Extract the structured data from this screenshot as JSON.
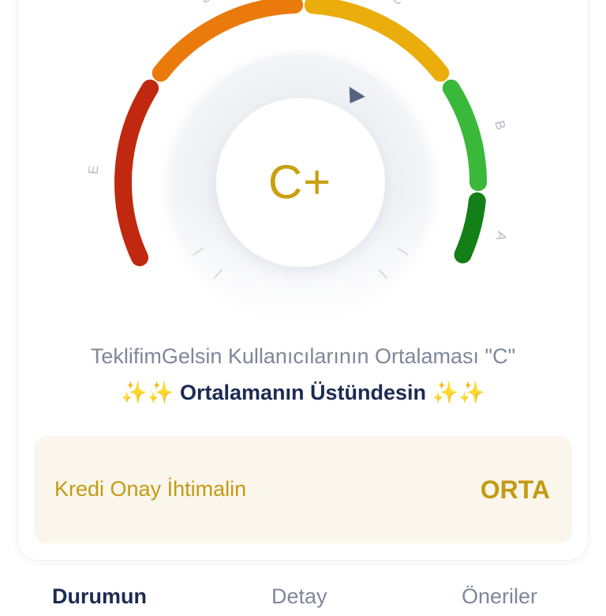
{
  "gauge": {
    "grade": "C+",
    "segments": [
      {
        "label": "E",
        "color": "#c0290f"
      },
      {
        "label": "D",
        "color": "#ea7a0c"
      },
      {
        "label": "C",
        "color": "#ebad0c"
      },
      {
        "label": "B",
        "color": "#3ab83a"
      },
      {
        "label": "A",
        "color": "#137f17"
      }
    ],
    "indicator_color": "#56657f"
  },
  "summary": {
    "average_text": "TeklifimGelsin Kullanıcılarının Ortalaması \"C\"",
    "sparkles": "✨✨",
    "above_text": "Ortalamanın Üstündesin"
  },
  "approval": {
    "label": "Kredi Onay İhtimalin",
    "value": "ORTA"
  },
  "tabs": [
    {
      "label": "Durumun",
      "active": true
    },
    {
      "label": "Detay",
      "active": false
    },
    {
      "label": "Öneriler",
      "active": false
    }
  ]
}
